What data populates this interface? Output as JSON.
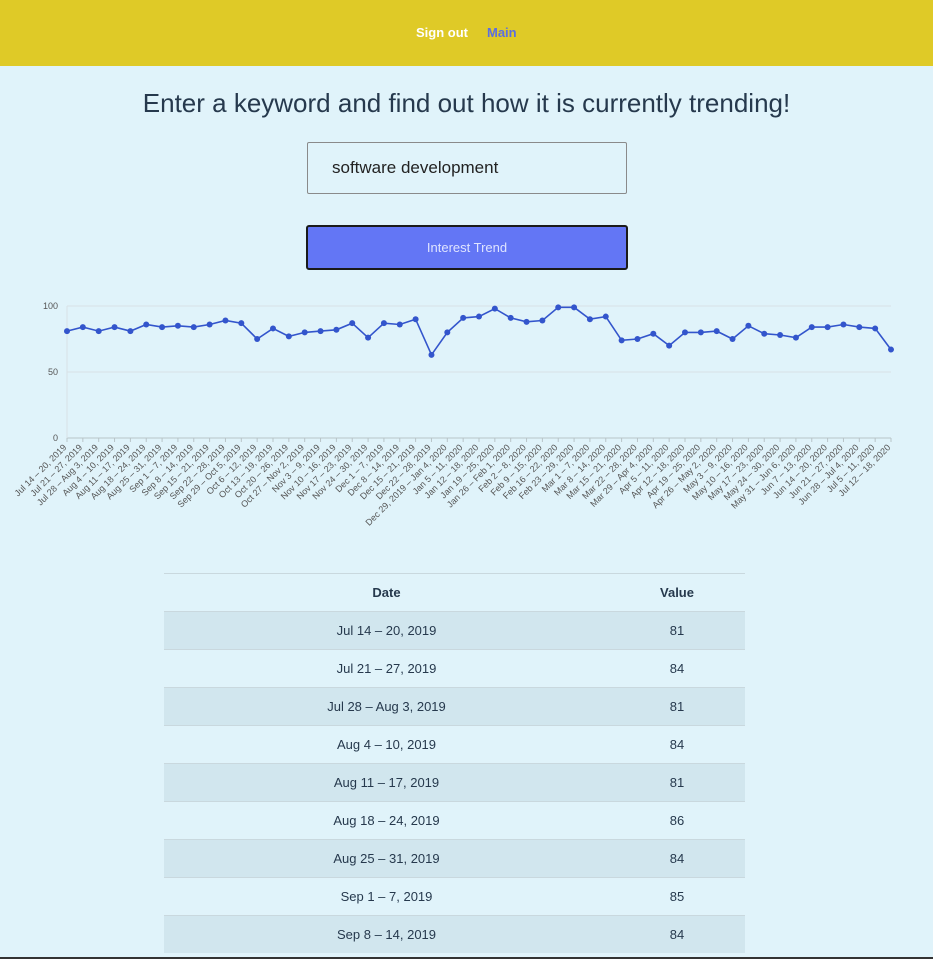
{
  "nav": {
    "sign_out": "Sign out",
    "main": "Main"
  },
  "headline": "Enter a keyword and find out how it is currently trending!",
  "search": {
    "value": "software development",
    "placeholder": ""
  },
  "trend_button": "Interest Trend",
  "colors": {
    "topbar": "#dfca27",
    "background": "#e0f3fa",
    "button": "#6376f5",
    "line": "#3355cc"
  },
  "chart_data": {
    "type": "line",
    "title": "",
    "xlabel": "",
    "ylabel": "",
    "ylim": [
      0,
      100
    ],
    "yticks": [
      0,
      50,
      100
    ],
    "grid": true,
    "categories": [
      "Jul 14 – 20, 2019",
      "Jul 21 – 27, 2019",
      "Jul 28 – Aug 3, 2019",
      "Aug 4 – 10, 2019",
      "Aug 11 – 17, 2019",
      "Aug 18 – 24, 2019",
      "Aug 25 – 31, 2019",
      "Sep 1 – 7, 2019",
      "Sep 8 – 14, 2019",
      "Sep 15 – 21, 2019",
      "Sep 22 – 28, 2019",
      "Sep 29 – Oct 5, 2019",
      "Oct 6 – 12, 2019",
      "Oct 13 – 19, 2019",
      "Oct 20 – 26, 2019",
      "Oct 27 – Nov 2, 2019",
      "Nov 3 – 9, 2019",
      "Nov 10 – 16, 2019",
      "Nov 17 – 23, 2019",
      "Nov 24 – 30, 2019",
      "Dec 1 – 7, 2019",
      "Dec 8 – 14, 2019",
      "Dec 15 – 21, 2019",
      "Dec 22 – 28, 2019",
      "Dec 29, 2019 – Jan 4, 2020",
      "Jan 5 – 11, 2020",
      "Jan 12 – 18, 2020",
      "Jan 19 – 25, 2020",
      "Jan 26 – Feb 1, 2020",
      "Feb 2 – 8, 2020",
      "Feb 9 – 15, 2020",
      "Feb 16 – 22, 2020",
      "Feb 23 – 29, 2020",
      "Mar 1 – 7, 2020",
      "Mar 8 – 14, 2020",
      "Mar 15 – 21, 2020",
      "Mar 22 – 28, 2020",
      "Mar 29 – Apr 4, 2020",
      "Apr 5 – 11, 2020",
      "Apr 12 – 18, 2020",
      "Apr 19 – 25, 2020",
      "Apr 26 – May 2, 2020",
      "May 3 – 9, 2020",
      "May 10 – 16, 2020",
      "May 17 – 23, 2020",
      "May 24 – 30, 2020",
      "May 31 – Jun 6, 2020",
      "Jun 7 – 13, 2020",
      "Jun 14 – 20, 2020",
      "Jun 21 – 27, 2020",
      "Jun 28 – Jul 4, 2020",
      "Jul 5 – 11, 2020",
      "Jul 12 – 18, 2020"
    ],
    "series": [
      {
        "name": "",
        "values": [
          81,
          84,
          81,
          84,
          81,
          86,
          84,
          85,
          84,
          86,
          89,
          87,
          75,
          83,
          77,
          80,
          81,
          82,
          87,
          76,
          87,
          86,
          90,
          63,
          80,
          91,
          92,
          98,
          91,
          88,
          89,
          99,
          99,
          90,
          92,
          74,
          75,
          79,
          70,
          80,
          80,
          81,
          75,
          85,
          79,
          78,
          76,
          84,
          84,
          86,
          84,
          83,
          67
        ]
      }
    ]
  },
  "table": {
    "headers": {
      "date": "Date",
      "value": "Value"
    },
    "rows": [
      {
        "date": "Jul 14 – 20, 2019",
        "value": "81"
      },
      {
        "date": "Jul 21 – 27, 2019",
        "value": "84"
      },
      {
        "date": "Jul 28 – Aug 3, 2019",
        "value": "81"
      },
      {
        "date": "Aug 4 – 10, 2019",
        "value": "84"
      },
      {
        "date": "Aug 11 – 17, 2019",
        "value": "81"
      },
      {
        "date": "Aug 18 – 24, 2019",
        "value": "86"
      },
      {
        "date": "Aug 25 – 31, 2019",
        "value": "84"
      },
      {
        "date": "Sep 1 – 7, 2019",
        "value": "85"
      },
      {
        "date": "Sep 8 – 14, 2019",
        "value": "84"
      }
    ]
  }
}
